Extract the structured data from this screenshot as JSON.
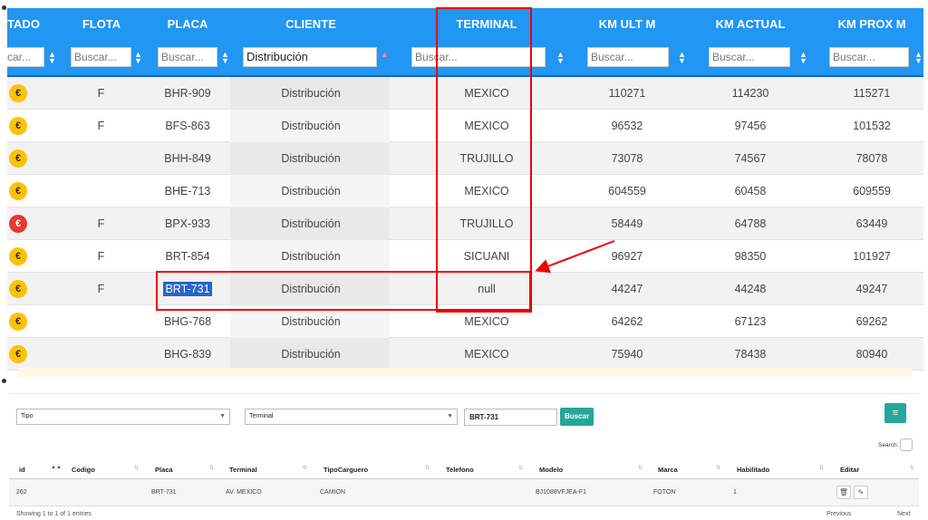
{
  "top_table": {
    "headers": [
      "TADO",
      "FLOTA",
      "PLACA",
      "CLIENTE",
      "TERMINAL",
      "KM ULT M",
      "KM ACTUAL",
      "KM PROX M"
    ],
    "filters": [
      "car...",
      "Buscar...",
      "Buscar...",
      "Distribución",
      "Buscar...",
      "Buscar...",
      "Buscar...",
      "Buscar..."
    ],
    "rows": [
      {
        "flota": "F",
        "placa": "BHR-909",
        "cliente": "Distribución",
        "terminal": "MEXICO",
        "km_ult": "110271",
        "km_actual": "114230",
        "km_prox": "115271",
        "status": "yellow"
      },
      {
        "flota": "F",
        "placa": "BFS-863",
        "cliente": "Distribución",
        "terminal": "MEXICO",
        "km_ult": "96532",
        "km_actual": "97456",
        "km_prox": "101532",
        "status": "yellow"
      },
      {
        "flota": "",
        "placa": "BHH-849",
        "cliente": "Distribución",
        "terminal": "TRUJILLO",
        "km_ult": "73078",
        "km_actual": "74567",
        "km_prox": "78078",
        "status": "yellow"
      },
      {
        "flota": "",
        "placa": "BHE-713",
        "cliente": "Distribución",
        "terminal": "MEXICO",
        "km_ult": "604559",
        "km_actual": "60458",
        "km_prox": "609559",
        "status": "yellow"
      },
      {
        "flota": "F",
        "placa": "BPX-933",
        "cliente": "Distribución",
        "terminal": "TRUJILLO",
        "km_ult": "58449",
        "km_actual": "64788",
        "km_prox": "63449",
        "status": "red"
      },
      {
        "flota": "F",
        "placa": "BRT-854",
        "cliente": "Distribución",
        "terminal": "SICUANI",
        "km_ult": "96927",
        "km_actual": "98350",
        "km_prox": "101927",
        "status": "yellow"
      },
      {
        "flota": "F",
        "placa": "BRT-731",
        "cliente": "Distribución",
        "terminal": "null",
        "km_ult": "44247",
        "km_actual": "44248",
        "km_prox": "49247",
        "status": "yellow"
      },
      {
        "flota": "",
        "placa": "BHG-768",
        "cliente": "Distribución",
        "terminal": "MEXICO",
        "km_ult": "64262",
        "km_actual": "67123",
        "km_prox": "69262",
        "status": "yellow"
      },
      {
        "flota": "",
        "placa": "BHG-839",
        "cliente": "Distribución",
        "terminal": "MEXICO",
        "km_ult": "75940",
        "km_actual": "78438",
        "km_prox": "80940",
        "status": "yellow"
      }
    ]
  },
  "bottom_form": {
    "tipo_placeholder": "Tipo",
    "terminal_placeholder": "Terminal",
    "search_value": "BRT-731",
    "search_button": "Buscar",
    "search_label": "Search:",
    "columns": [
      "id",
      "Codigo",
      "Placa",
      "Terminal",
      "TipoCarguero",
      "Telefono",
      "Modelo",
      "Marca",
      "Habilitado",
      "Editar"
    ],
    "row": {
      "id": "262",
      "codigo": "",
      "placa": "BRT-731",
      "terminal": "AV. MEXICO",
      "tipo": "CAMION",
      "telefono": "",
      "modelo": "BJ1088VFJEA-F1",
      "marca": "FOTON",
      "habilitado": "1"
    },
    "footer_left": "Showing 1 to 1 of 1 entries",
    "prev": "Previous",
    "next": "Next"
  },
  "colors": {
    "header": "#2196f3",
    "annotation": "#e00000",
    "accent_button": "#26a69a",
    "status_yellow": "#ffc107",
    "status_red": "#e53935"
  }
}
